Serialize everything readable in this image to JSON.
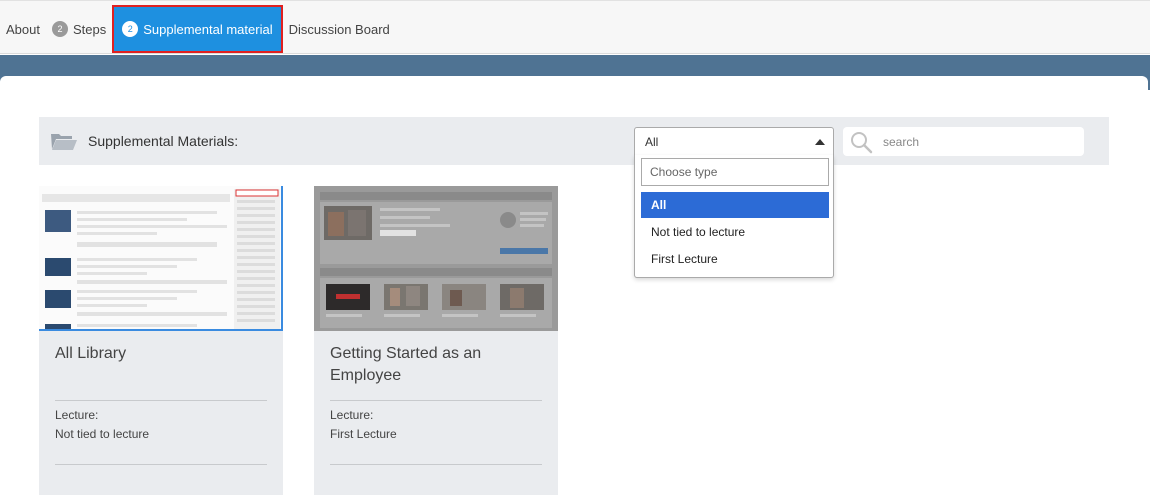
{
  "tabs": [
    {
      "label": "About",
      "count": ""
    },
    {
      "label": "Steps",
      "count": "2"
    },
    {
      "label": "Supplemental material",
      "count": "2"
    },
    {
      "label": "Discussion Board",
      "count": ""
    }
  ],
  "toolbar": {
    "title": "Supplemental Materials:",
    "type_select": {
      "value": "All"
    },
    "search": {
      "placeholder": "search",
      "value": ""
    }
  },
  "dropdown": {
    "search_placeholder": "Choose type",
    "options": [
      {
        "label": "All",
        "selected": true
      },
      {
        "label": "Not tied to lecture",
        "selected": false
      },
      {
        "label": "First Lecture",
        "selected": false
      }
    ]
  },
  "cards": [
    {
      "title": "All Library",
      "lecture_label": "Lecture:",
      "lecture_value": "Not tied to lecture"
    },
    {
      "title": "Getting Started as an Employee",
      "lecture_label": "Lecture:",
      "lecture_value": "First Lecture"
    }
  ],
  "colors": {
    "active_tab": "#1e90e0",
    "active_outline": "#e02020",
    "header_band": "#4f7393",
    "selected_option": "#2c6bd6"
  }
}
